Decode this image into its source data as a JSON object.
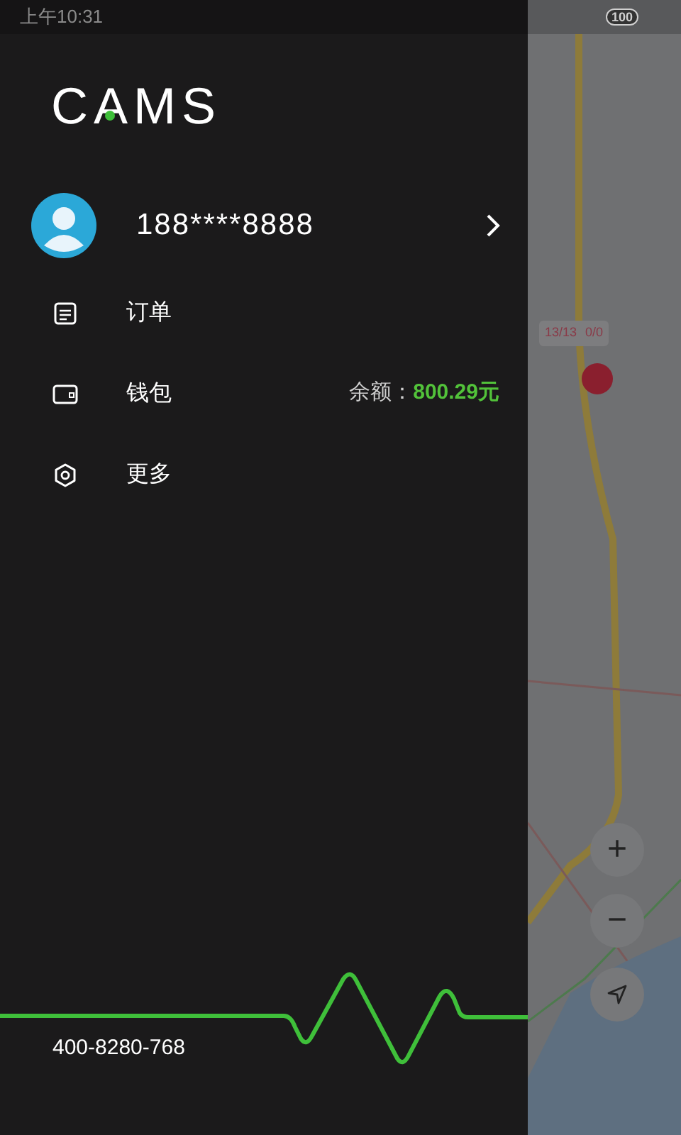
{
  "status_bar": {
    "time": "上午10:31",
    "battery": "100"
  },
  "drawer": {
    "logo": "CAMS",
    "user": {
      "phone": "188****8888"
    },
    "menu": [
      {
        "kind": "orders",
        "label": "订单"
      },
      {
        "kind": "wallet",
        "label": "钱包",
        "balance_label": "余额：",
        "balance": "800.29元"
      },
      {
        "kind": "more",
        "label": "更多"
      }
    ],
    "hotline": "400-8280-768"
  },
  "map": {
    "badge": {
      "first": "13/13",
      "second": "0/0"
    },
    "zoom_in": "+",
    "zoom_out": "−"
  }
}
